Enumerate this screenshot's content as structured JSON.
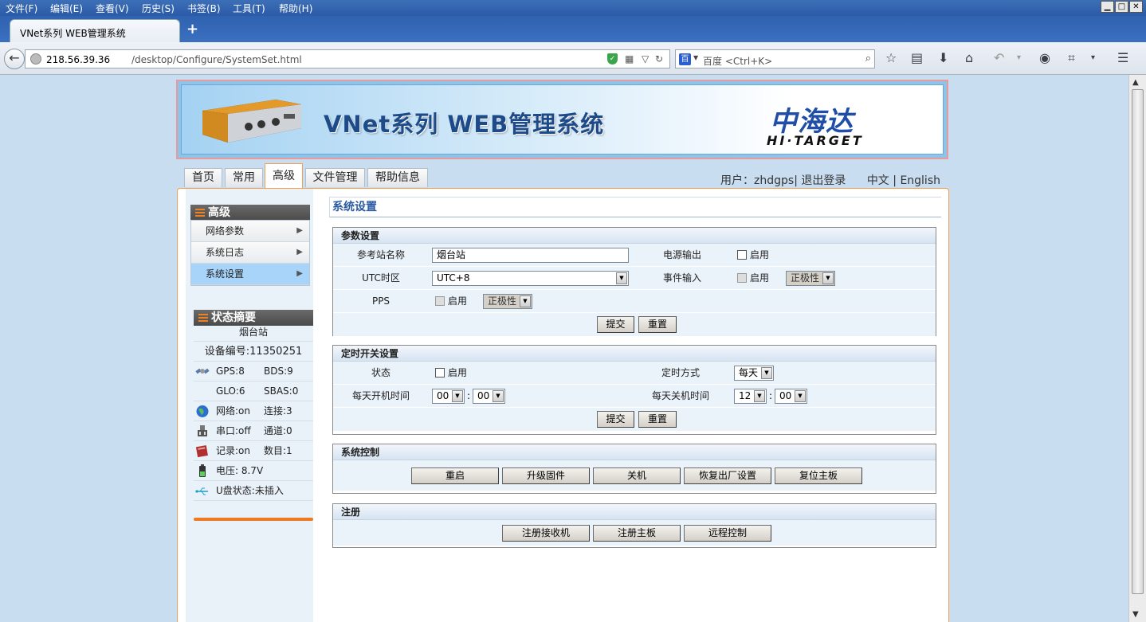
{
  "browser": {
    "menu": [
      {
        "label": "文件(F)"
      },
      {
        "label": "编辑(E)"
      },
      {
        "label": "查看(V)"
      },
      {
        "label": "历史(S)"
      },
      {
        "label": "书签(B)"
      },
      {
        "label": "工具(T)"
      },
      {
        "label": "帮助(H)"
      }
    ],
    "tab_title": "VNet系列 WEB管理系统",
    "new_tab": "+",
    "url_host": "218.56.39.36",
    "url_path": "/desktop/Configure/SystemSet.html",
    "search_engine": "百度",
    "search_placeholder": "百度 <Ctrl+K>"
  },
  "banner": {
    "title": "VNet系列 WEB管理系统",
    "logo_cn": "中海达",
    "logo_en": "HI·TARGET"
  },
  "nav": {
    "tabs": [
      {
        "label": "首页"
      },
      {
        "label": "常用"
      },
      {
        "label": "高级"
      },
      {
        "label": "文件管理"
      },
      {
        "label": "帮助信息"
      }
    ],
    "active_tab": "高级",
    "user_label": "用户：",
    "username": "zhdgps",
    "logout": "| 退出登录",
    "lang_cn": "中文",
    "lang_sep": " | ",
    "lang_en": "English"
  },
  "sidebar": {
    "menu_title": "高级",
    "items": [
      {
        "label": "网络参数"
      },
      {
        "label": "系统日志"
      },
      {
        "label": "系统设置"
      }
    ],
    "active_item": "系统设置",
    "status_title": "状态摘要",
    "station_name": "烟台站",
    "device_no": "设备编号:11350251",
    "gps": "GPS:8",
    "bds": "BDS:9",
    "glo": "GLO:6",
    "sbas": "SBAS:0",
    "network": "网络:on",
    "connect": "连接:3",
    "serial": "串口:off",
    "channel": "通道:0",
    "record": "记录:on",
    "count": "数目:1",
    "voltage": "电压: 8.7V",
    "usb": "U盘状态:未插入"
  },
  "main": {
    "title": "系统设置",
    "params": {
      "head": "参数设置",
      "station_label": "参考站名称",
      "station_value": "烟台站",
      "power_label": "电源输出",
      "enable": "启用",
      "utc_label": "UTC时区",
      "utc_value": "UTC+8",
      "event_label": "事件输入",
      "polarity": "正极性",
      "pps_label": "PPS",
      "submit": "提交",
      "reset": "重置"
    },
    "timer": {
      "head": "定时开关设置",
      "status_label": "状态",
      "enable": "启用",
      "mode_label": "定时方式",
      "mode_value": "每天",
      "on_label": "每天开机时间",
      "on_hour": "00",
      "on_min": "00",
      "off_label": "每天关机时间",
      "off_hour": "12",
      "off_min": "00",
      "colon": ":",
      "submit": "提交",
      "reset": "重置"
    },
    "control": {
      "head": "系统控制",
      "buttons": [
        {
          "label": "重启"
        },
        {
          "label": "升级固件"
        },
        {
          "label": "关机"
        },
        {
          "label": "恢复出厂设置"
        },
        {
          "label": "复位主板"
        }
      ]
    },
    "register": {
      "head": "注册",
      "buttons": [
        {
          "label": "注册接收机"
        },
        {
          "label": "注册主板"
        },
        {
          "label": "远程控制"
        }
      ]
    }
  }
}
